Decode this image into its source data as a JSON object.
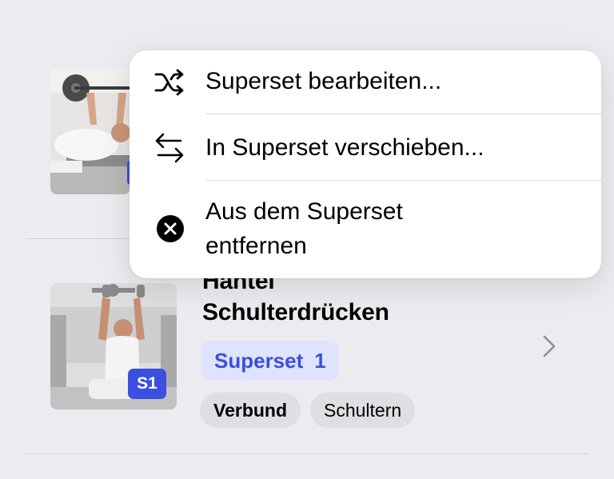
{
  "context_menu": {
    "items": [
      {
        "label": "Superset bearbeiten...",
        "icon": "shuffle-icon"
      },
      {
        "label": "In Superset verschieben...",
        "icon": "arrows-swap-icon"
      },
      {
        "label_line1": "Aus dem Superset",
        "label_line2": "entfernen",
        "icon": "xmark-circle-icon"
      }
    ]
  },
  "exercise": {
    "title_line1": "Hantel",
    "title_line2": "Schulterdrücken",
    "superset_label": "Superset",
    "superset_number": "1",
    "badge": "S1",
    "tags": [
      "Verbund",
      "Schultern"
    ]
  },
  "colors": {
    "accent": "#3b4fe0",
    "chip_bg": "#dfe3fb",
    "background": "#ececf0"
  }
}
